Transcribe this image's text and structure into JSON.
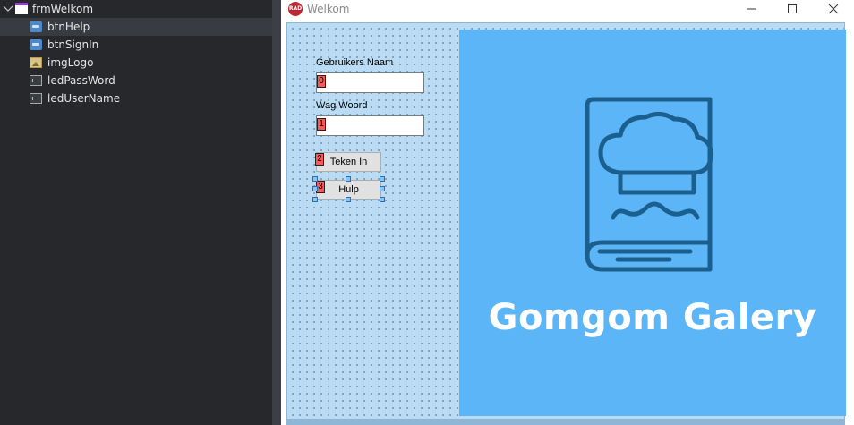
{
  "structure": {
    "root": "frmWelkom",
    "items": [
      {
        "label": "btnHelp",
        "icon": "button-icon",
        "selected": true
      },
      {
        "label": "btnSignIn",
        "icon": "button-icon",
        "selected": false
      },
      {
        "label": "imgLogo",
        "icon": "image-icon",
        "selected": false
      },
      {
        "label": "ledPassWord",
        "icon": "labeled-edit-icon",
        "selected": false
      },
      {
        "label": "ledUserName",
        "icon": "labeled-edit-icon",
        "selected": false
      }
    ]
  },
  "form": {
    "title": "Welkom",
    "app_icon_text": "RAD",
    "username_label": "Gebruikers Naam",
    "password_label": "Wag Woord",
    "username_value": "",
    "password_value": "",
    "tab_orders": [
      "0",
      "1",
      "2",
      "3"
    ],
    "sign_in_button": "Teken In",
    "help_button": "Hulp",
    "logo_text": "Gomgom Galery"
  },
  "colors": {
    "logo_background": "#5bb5f6",
    "logo_lines": "#1b5f8f",
    "selection_accent": "#2a6eb3"
  }
}
